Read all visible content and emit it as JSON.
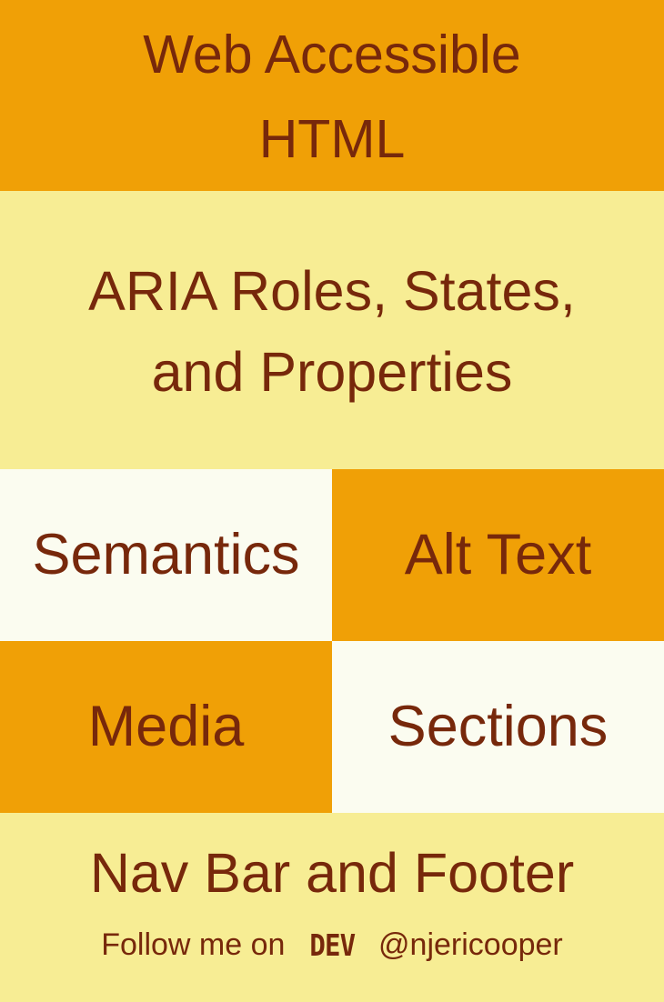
{
  "colors": {
    "text": "#77280b",
    "orange": "#f0a006",
    "light_yellow": "#f7ed94",
    "cream": "#fbfcf0"
  },
  "title": {
    "line1": "Web Accessible",
    "line2": "HTML"
  },
  "aria": {
    "line1": "ARIA Roles, States,",
    "line2": "and Properties"
  },
  "grid": {
    "semantics": "Semantics",
    "alt_text": "Alt Text",
    "media": "Media",
    "sections": "Sections"
  },
  "footer": {
    "title": "Nav Bar and Footer",
    "follow_text": "Follow me on",
    "logo_text": "DEV",
    "handle": "@njericooper"
  }
}
